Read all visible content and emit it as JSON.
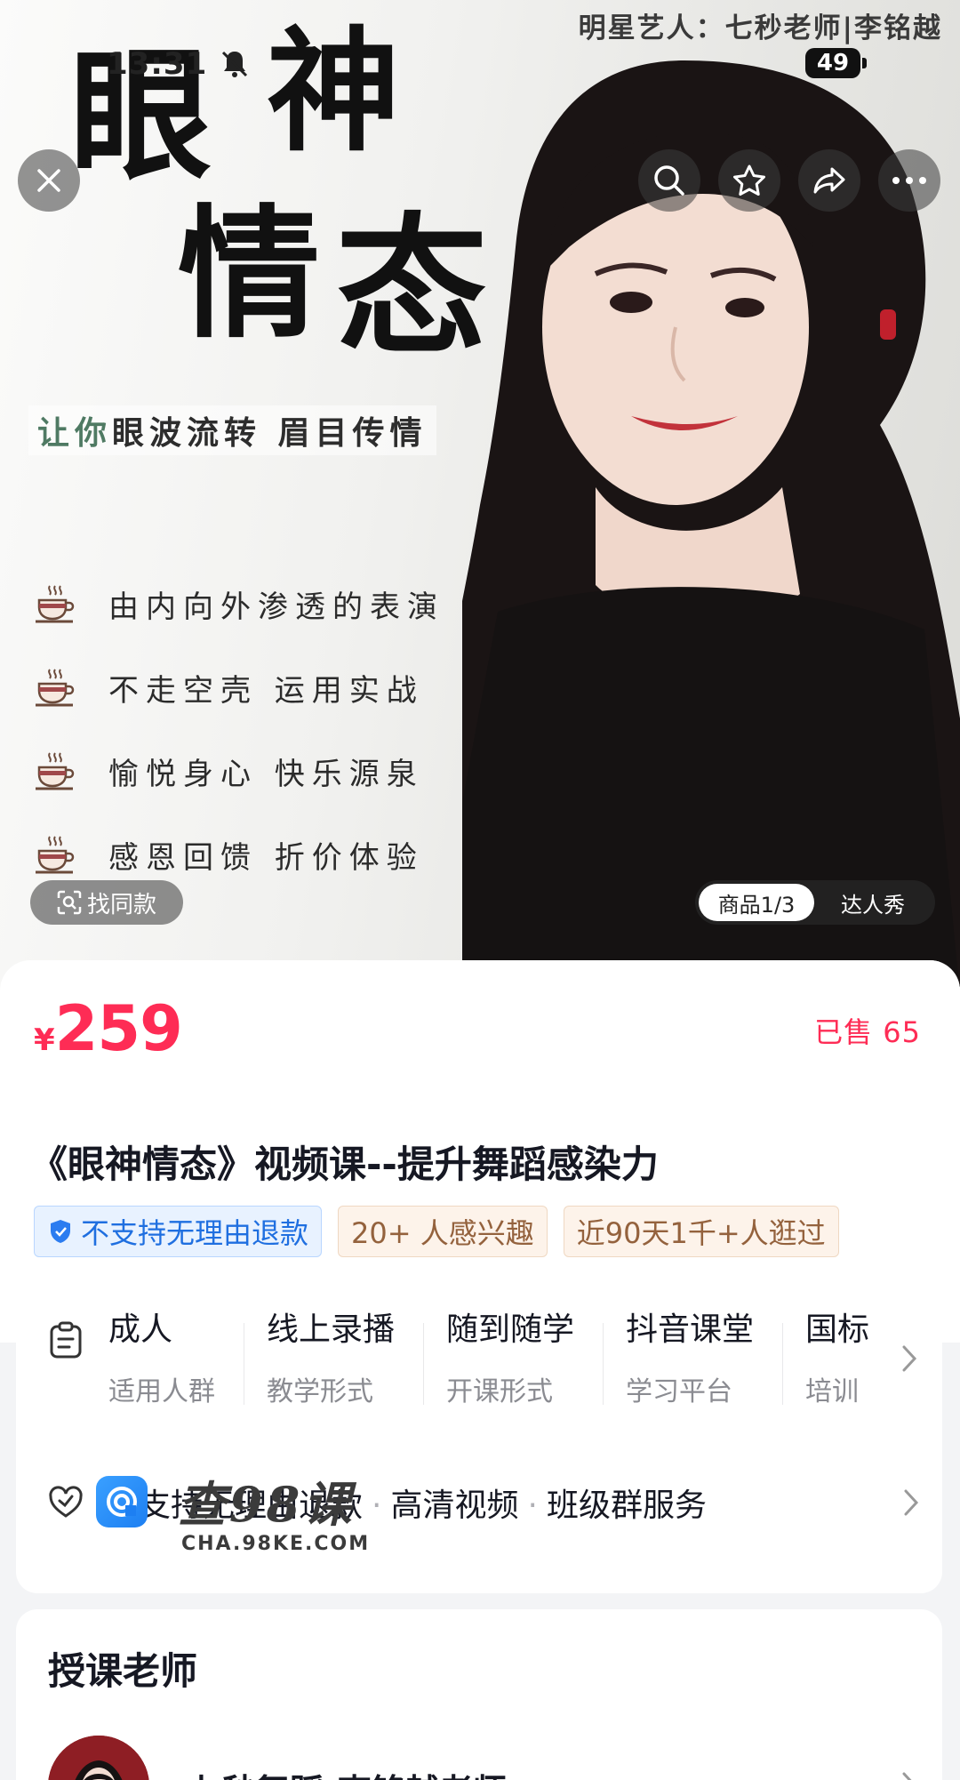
{
  "status_bar": {
    "time": "13:31",
    "battery": "49"
  },
  "hero": {
    "brand_line": "明星艺人：七秒老师|李铭越",
    "title_chars": [
      "眼",
      "神",
      "情",
      "态"
    ],
    "slogan_green": "让你",
    "slogan_rest": "眼波流转 眉目传情",
    "features": [
      "由内向外渗透的表演",
      "不走空壳 运用实战",
      "愉悦身心 快乐源泉",
      "感恩回馈 折价体验"
    ],
    "find_similar_label": "找同款",
    "switch_active": "商品1/3",
    "switch_inactive": "达人秀"
  },
  "product": {
    "currency": "¥",
    "price": "259",
    "sold": "已售 65",
    "title": "《眼神情态》视频课--提升舞蹈感染力",
    "tags": {
      "refund": "不支持无理由退款",
      "interest": "20+ 人感兴趣",
      "visits": "近90天1千+人逛过"
    }
  },
  "attributes": [
    {
      "value": "成人",
      "key": "适用人群"
    },
    {
      "value": "线上录播",
      "key": "教学形式"
    },
    {
      "value": "随到随学",
      "key": "开课形式"
    },
    {
      "value": "抖音课堂",
      "key": "学习平台"
    },
    {
      "value": "国标",
      "key": "培训"
    }
  ],
  "services": {
    "items": [
      "不支持无理由退款",
      "高清视频",
      "班级群服务"
    ],
    "separator": "·"
  },
  "watermark": {
    "text": "查98课",
    "url": "CHA.98KE.COM"
  },
  "teacher": {
    "section_title": "授课老师",
    "name": "七秒舞蹈-李铭越老师"
  },
  "colors": {
    "accent": "#fe2c55",
    "tag_blue": "#1f6fe0",
    "tag_brown": "#94623d"
  }
}
